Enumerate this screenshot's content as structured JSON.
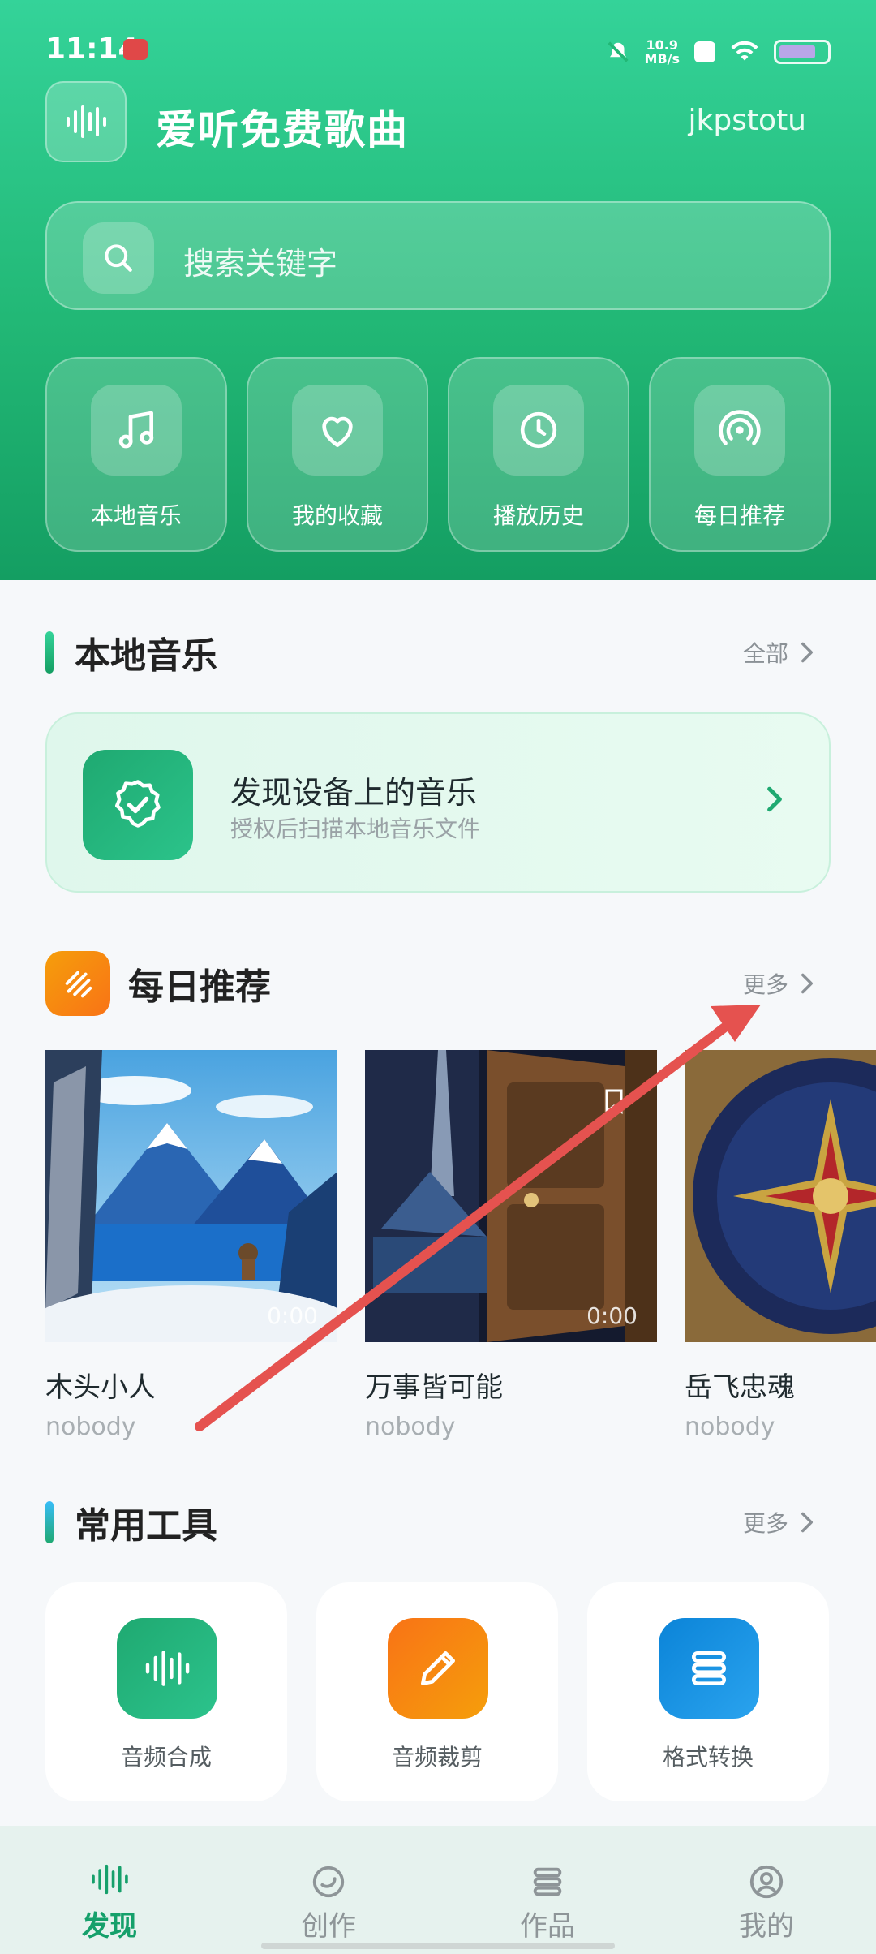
{
  "status_bar": {
    "time": "11:14",
    "speed_value": "10.9",
    "speed_unit": "MB/s"
  },
  "header": {
    "app_title": "爱听免费歌曲",
    "user_name": "jkpstotu"
  },
  "search": {
    "placeholder": "搜索关键字"
  },
  "quick_actions": [
    {
      "label": "本地音乐",
      "icon": "music-note-icon"
    },
    {
      "label": "我的收藏",
      "icon": "heart-icon"
    },
    {
      "label": "播放历史",
      "icon": "clock-icon"
    },
    {
      "label": "每日推荐",
      "icon": "radar-icon"
    }
  ],
  "local_section": {
    "title": "本地音乐",
    "more": "全部",
    "card_title": "发现设备上的音乐",
    "card_subtitle": "授权后扫描本地音乐文件"
  },
  "daily_section": {
    "title": "每日推荐",
    "more": "更多",
    "songs": [
      {
        "title": "木头小人",
        "artist": "nobody",
        "duration": "0:00"
      },
      {
        "title": "万事皆可能",
        "artist": "nobody",
        "duration": "0:00"
      },
      {
        "title": "岳飞忠魂",
        "artist": "nobody",
        "duration": ""
      }
    ]
  },
  "tools_section": {
    "title": "常用工具",
    "more": "更多",
    "tools": [
      {
        "label": "音频合成",
        "icon": "waveform-icon",
        "color": "#1fa971"
      },
      {
        "label": "音频裁剪",
        "icon": "pencil-icon",
        "color": "#f97316"
      },
      {
        "label": "格式转换",
        "icon": "stack-icon",
        "color": "#0b84d8"
      }
    ]
  },
  "bottom_nav": [
    {
      "label": "发现",
      "active": true
    },
    {
      "label": "创作",
      "active": false
    },
    {
      "label": "作品",
      "active": false
    },
    {
      "label": "我的",
      "active": false
    }
  ],
  "colors": {
    "brand_green": "#1fa971",
    "accent_orange": "#f97316",
    "accent_blue": "#0b84d8",
    "annotation_red": "#e5524f"
  }
}
